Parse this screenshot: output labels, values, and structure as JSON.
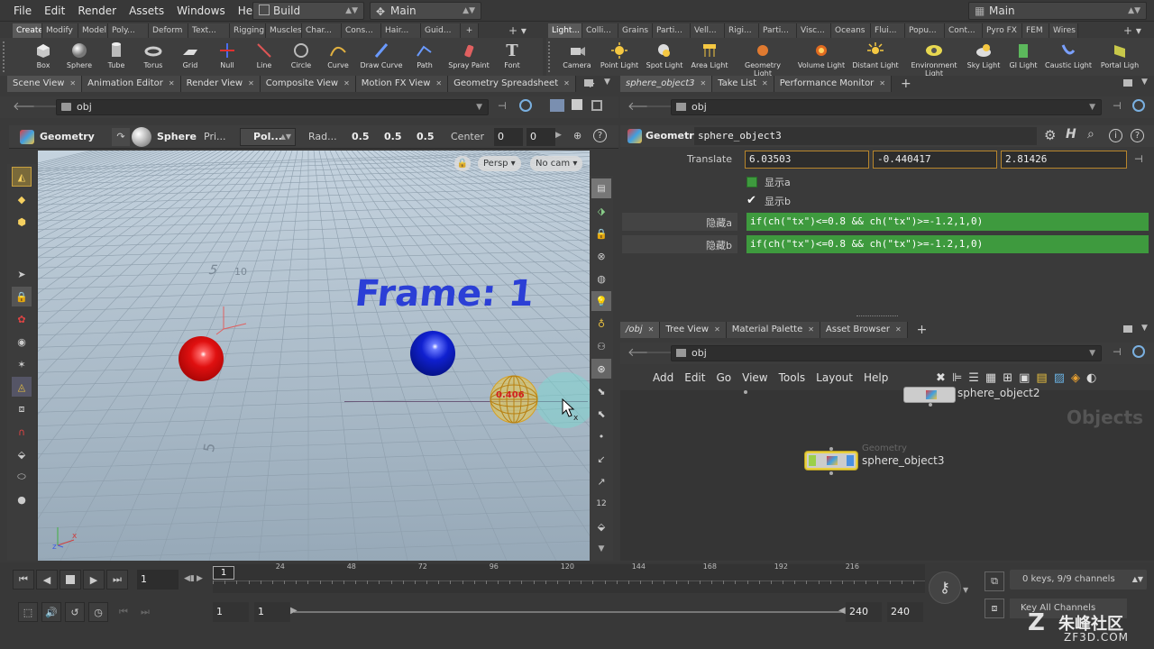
{
  "menubar": {
    "items": [
      "File",
      "Edit",
      "Render",
      "Assets",
      "Windows",
      "Help"
    ],
    "desktop": "Build",
    "context": "Main",
    "right_desktop": "Main"
  },
  "shelf_left": {
    "tabs": [
      "Create",
      "Modify",
      "Model",
      "Poly...",
      "Deform",
      "Text...",
      "Rigging",
      "Muscles",
      "Char...",
      "Cons...",
      "Hair...",
      "Guid..."
    ],
    "tools": [
      "Box",
      "Sphere",
      "Tube",
      "Torus",
      "Grid",
      "Null",
      "Line",
      "Circle",
      "Curve",
      "Draw Curve",
      "Path",
      "Spray Paint",
      "Font"
    ]
  },
  "shelf_right": {
    "tabs": [
      "Light...",
      "Colli...",
      "Grains",
      "Parti...",
      "Vell...",
      "Rigi...",
      "Parti...",
      "Visc...",
      "Oceans",
      "Flui...",
      "Popu...",
      "Cont...",
      "Pyro FX",
      "FEM",
      "Wires"
    ],
    "tools": [
      "Camera",
      "Point Light",
      "Spot Light",
      "Area Light",
      "Geometry Light",
      "Volume Light",
      "Distant Light",
      "Environment Light",
      "Sky Light",
      "GI Light",
      "Caustic Light",
      "Portal Ligh"
    ]
  },
  "left_pane": {
    "tabs": [
      "Scene View",
      "Animation Editor",
      "Render View",
      "Composite View",
      "Motion FX View",
      "Geometry Spreadsheet"
    ],
    "path": "obj",
    "toolbar": {
      "geometry_label": "Geometry",
      "sphere_label": "Sphere",
      "prim_label": "Pri...",
      "poly_label": "Pol...",
      "rad_label": "Rad...",
      "rad_x": "0.5",
      "rad_y": "0.5",
      "rad_z": "0.5",
      "center_label": "Center",
      "center_x": "0",
      "center_y": "0"
    },
    "viewport": {
      "persp": "Persp",
      "cam": "No cam",
      "frame_text": "Frame: 1",
      "value_label": "0.406",
      "grid_labels": [
        "5",
        "5",
        "10"
      ]
    }
  },
  "right_top": {
    "tabs": [
      "sphere_object3",
      "Take List",
      "Performance Monitor"
    ],
    "path": "obj",
    "node_type": "Geometry",
    "node_name": "sphere_object3",
    "translate_label": "Translate",
    "tx": "6.03503",
    "ty": "-0.440417",
    "tz": "2.81426",
    "toggle_a_label": "显示a",
    "toggle_b_label": "显示b",
    "toggle_a": false,
    "toggle_b": true,
    "hide_a_label": "隐藏a",
    "hide_b_label": "隐藏b",
    "hide_a_expr": "if(ch(\"tx\")<=0.8 && ch(\"tx\")>=-1.2,1,0)",
    "hide_b_expr": "if(ch(\"tx\")<=0.8 && ch(\"tx\")>=-1.2,1,0)"
  },
  "right_bottom": {
    "tabs": [
      "/obj",
      "Tree View",
      "Material Palette",
      "Asset Browser"
    ],
    "path": "obj",
    "menu": [
      "Add",
      "Edit",
      "Go",
      "View",
      "Tools",
      "Layout",
      "Help"
    ],
    "context_label": "Objects",
    "node1_name": "sphere_object2",
    "node2_type": "Geometry",
    "node2_name": "sphere_object3"
  },
  "timeline": {
    "current_frame": "1",
    "frame_field": "1",
    "ticks": [
      "24",
      "48",
      "72",
      "96",
      "120",
      "144",
      "168",
      "192",
      "216"
    ],
    "range_start": "1",
    "range_start2": "1",
    "range_end": "240",
    "range_end2": "240",
    "keys_info": "0 keys, 9/9 channels",
    "key_all": "Key All Channels"
  },
  "watermark": {
    "brand": "朱峰社区",
    "url": "ZF3D.COM"
  },
  "colors": {
    "accent_green": "#3e9a3e",
    "frame_text": "#2b3fd6",
    "red_ball": "#e01010",
    "blue_ball": "#1020d0"
  }
}
